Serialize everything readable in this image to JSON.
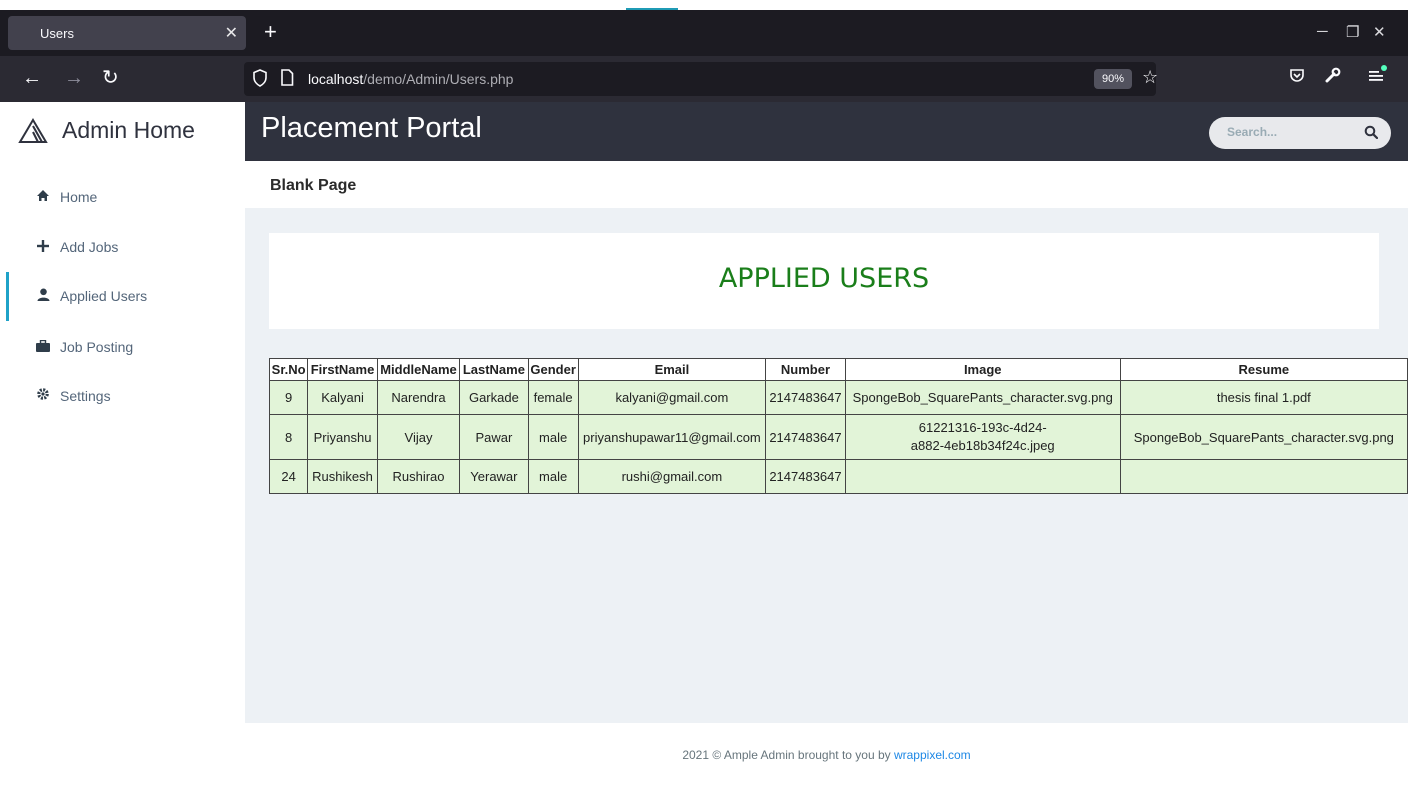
{
  "browser": {
    "tab_title": "Users",
    "tab_close": "✕",
    "new_tab": "+",
    "url_host": "localhost",
    "url_path": "/demo/Admin/Users.php",
    "zoom": "90%"
  },
  "sidebar": {
    "brand": "Admin Home",
    "items": [
      {
        "label": "Home",
        "icon": "home-icon"
      },
      {
        "label": "Add Jobs",
        "icon": "plus-icon"
      },
      {
        "label": "Applied Users",
        "icon": "user-icon",
        "active": true
      },
      {
        "label": "Job Posting",
        "icon": "briefcase-icon"
      },
      {
        "label": "Settings",
        "icon": "gear-icon"
      }
    ]
  },
  "header": {
    "title": "Placement Portal",
    "search_placeholder": "Search..."
  },
  "page": {
    "title": "Blank Page",
    "card_title": "APPLIED USERS"
  },
  "table": {
    "columns": [
      "Sr.No",
      "FirstName",
      "MiddleName",
      "LastName",
      "Gender",
      "Email",
      "Number",
      "Image",
      "Resume"
    ],
    "rows": [
      [
        "9",
        "Kalyani",
        "Narendra",
        "Garkade",
        "female",
        "kalyani@gmail.com",
        "2147483647",
        "SpongeBob_SquarePants_character.svg.png",
        "thesis final 1.pdf"
      ],
      [
        "8",
        "Priyanshu",
        "Vijay",
        "Pawar",
        "male",
        "priyanshupawar11@gmail.com",
        "2147483647",
        "61221316-193c-4d24-a882-4eb18b34f24c.jpeg",
        "SpongeBob_SquarePants_character.svg.png"
      ],
      [
        "24",
        "Rushikesh",
        "Rushirao",
        "Yerawar",
        "male",
        "rushi@gmail.com",
        "2147483647",
        "",
        ""
      ]
    ]
  },
  "footer": {
    "text": "2021 © Ample Admin brought to you by ",
    "link": "wrappixel.com"
  },
  "colors": {
    "header_bg": "#2f323e",
    "accent": "#1fa2c8",
    "card_title": "#1a7e1a",
    "table_row_bg": "#e2f4d8"
  }
}
